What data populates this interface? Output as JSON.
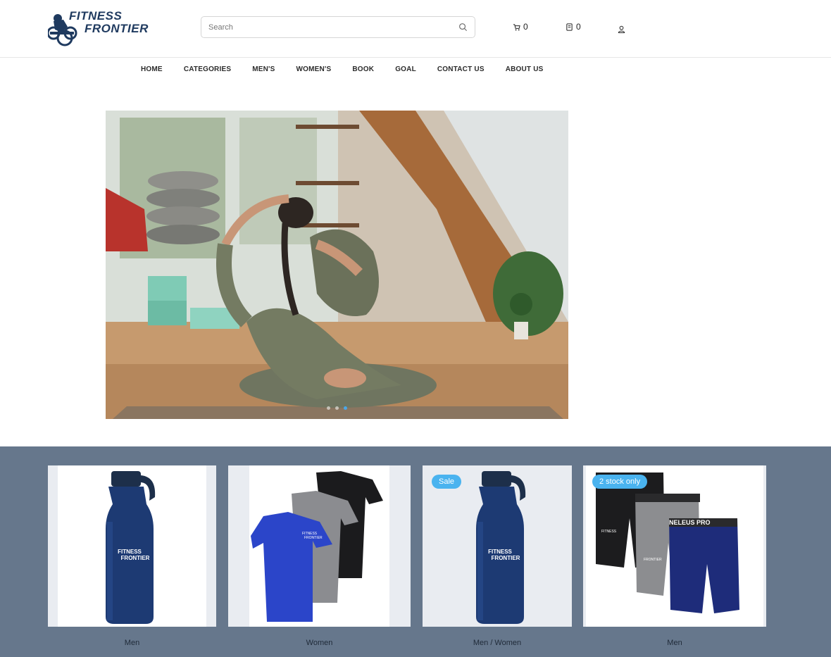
{
  "header": {
    "logo": {
      "line1": "FITNESS",
      "line2": "FRONTIER"
    },
    "search": {
      "placeholder": "Search"
    },
    "cart_count": "0",
    "bookings_count": "0"
  },
  "nav": {
    "items": [
      {
        "label": "HOME"
      },
      {
        "label": "CATEGORIES"
      },
      {
        "label": "MEN'S"
      },
      {
        "label": "WOMEN'S"
      },
      {
        "label": "BOOK"
      },
      {
        "label": "GOAL"
      },
      {
        "label": "CONTACT US"
      },
      {
        "label": "ABOUT US"
      }
    ]
  },
  "hero": {
    "slide_count": 3,
    "active_slide": 3
  },
  "products": [
    {
      "category": "Men",
      "badge": "",
      "image": "water-bottle"
    },
    {
      "category": "Women",
      "badge": "",
      "image": "womens-tshirts"
    },
    {
      "category": "Men / Women",
      "badge": "Sale",
      "image": "water-bottle"
    },
    {
      "category": "Men",
      "badge": "2 stock only",
      "image": "compression-shorts"
    }
  ],
  "product_print": {
    "line1": "FITNESS",
    "line2": "FRONTIER",
    "shorts_band": "NELEUS PRO"
  },
  "colors": {
    "brand": "#1f3a5f",
    "accent": "#4ab3ef",
    "band": "#66778c"
  }
}
